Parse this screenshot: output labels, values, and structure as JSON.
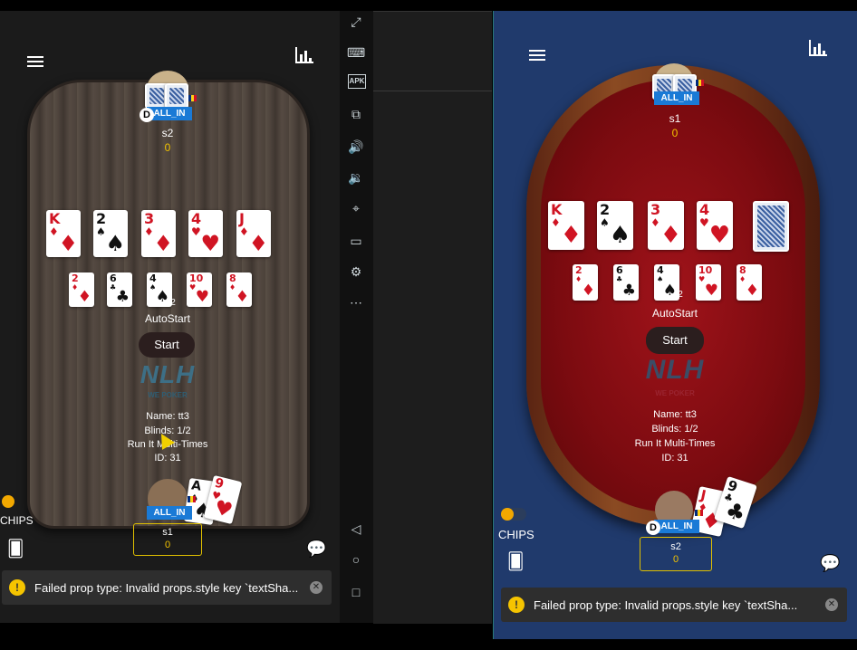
{
  "left_phone": {
    "top_seat": {
      "name": "s2",
      "chips": "0",
      "status": "ALL_IN",
      "dealer": "D"
    },
    "bottom_seat": {
      "name": "s1",
      "chips": "0",
      "status": "ALL_IN"
    },
    "board": [
      {
        "rank": "K",
        "suit": "♦",
        "color": "red"
      },
      {
        "rank": "2",
        "suit": "♠",
        "color": "black"
      },
      {
        "rank": "3",
        "suit": "♦",
        "color": "red"
      },
      {
        "rank": "4",
        "suit": "♥",
        "color": "red"
      },
      {
        "rank": "J",
        "suit": "♦",
        "color": "red"
      }
    ],
    "second_board": [
      {
        "rank": "2",
        "suit": "♦",
        "color": "red"
      },
      {
        "rank": "6",
        "suit": "♣",
        "color": "black"
      },
      {
        "rank": "4",
        "suit": "♠",
        "color": "black"
      },
      {
        "rank": "10",
        "suit": "♥",
        "color": "red"
      },
      {
        "rank": "8",
        "suit": "♦",
        "color": "red"
      }
    ],
    "pot_fragment": "2",
    "hole_cards": [
      {
        "rank": "A",
        "suit": "♠",
        "color": "black"
      },
      {
        "rank": "9",
        "suit": "♥",
        "color": "red"
      }
    ],
    "autostart": "AutoStart",
    "start_button": "Start",
    "logo": "NLH",
    "logo_sub": "WE POKER",
    "info": {
      "name": "Name: tt3",
      "blinds": "Blinds: 1/2",
      "run": "Run It Multi-Times",
      "id": "ID: 31"
    },
    "chips_label": "CHIPS",
    "toast": "Failed prop type: Invalid props.style key `textSha..."
  },
  "toolbar": {
    "icons": [
      "fullscreen-icon",
      "keyboard-icon",
      "apk-icon",
      "copy-icon",
      "volume-up-icon",
      "volume-down-icon",
      "location-icon",
      "folder-icon",
      "settings-icon",
      "more-icon",
      "back-icon",
      "home-icon",
      "recents-icon"
    ],
    "apk_label": "APK"
  },
  "right_phone": {
    "top_seat": {
      "name": "s1",
      "chips": "0",
      "status": "ALL_IN"
    },
    "bottom_seat": {
      "name": "s2",
      "chips": "0",
      "status": "ALL_IN",
      "dealer": "D"
    },
    "board": [
      {
        "rank": "K",
        "suit": "♦",
        "color": "red"
      },
      {
        "rank": "2",
        "suit": "♠",
        "color": "black"
      },
      {
        "rank": "3",
        "suit": "♦",
        "color": "red"
      },
      {
        "rank": "4",
        "suit": "♥",
        "color": "red"
      }
    ],
    "second_board": [
      {
        "rank": "2",
        "suit": "♦",
        "color": "red"
      },
      {
        "rank": "6",
        "suit": "♣",
        "color": "black"
      },
      {
        "rank": "4",
        "suit": "♠",
        "color": "black"
      },
      {
        "rank": "10",
        "suit": "♥",
        "color": "red"
      },
      {
        "rank": "8",
        "suit": "♦",
        "color": "red"
      }
    ],
    "pot_fragment": "2",
    "hole_cards": [
      {
        "rank": "J",
        "suit": "♦",
        "color": "red"
      },
      {
        "rank": "9",
        "suit": "♣",
        "color": "black"
      }
    ],
    "autostart": "AutoStart",
    "start_button": "Start",
    "logo": "NLH",
    "logo_sub": "WE POKER",
    "info": {
      "name": "Name: tt3",
      "blinds": "Blinds: 1/2",
      "run": "Run It Multi-Times",
      "id": "ID: 31"
    },
    "chips_label": "CHIPS",
    "toast": "Failed prop type: Invalid props.style key `textSha..."
  },
  "colors": {
    "allin": "#1a7ad6",
    "gold": "#f2c300",
    "right_bg": "#203a6c",
    "felt": "#8e0f15"
  }
}
